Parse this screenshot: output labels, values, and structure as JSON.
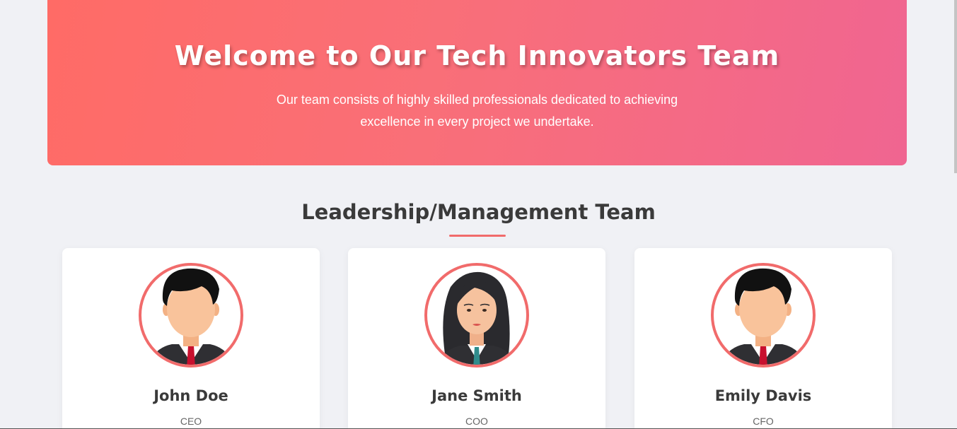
{
  "hero": {
    "title": "Welcome to Our Tech Innovators Team",
    "description": "Our team consists of highly skilled professionals dedicated to achieving excellence in every project we undertake."
  },
  "section": {
    "title": "Leadership/Management Team"
  },
  "members": [
    {
      "name": "John Doe",
      "role": "CEO",
      "avatar": "male-avatar-icon"
    },
    {
      "name": "Jane Smith",
      "role": "COO",
      "avatar": "female-avatar-icon"
    },
    {
      "name": "Emily Davis",
      "role": "CFO",
      "avatar": "male-avatar-icon"
    }
  ],
  "colors": {
    "hero_start": "#ff6b66",
    "hero_end": "#f06591",
    "accent": "#f16b6b",
    "background": "#f0f1f5",
    "text": "#3a3a3a"
  }
}
